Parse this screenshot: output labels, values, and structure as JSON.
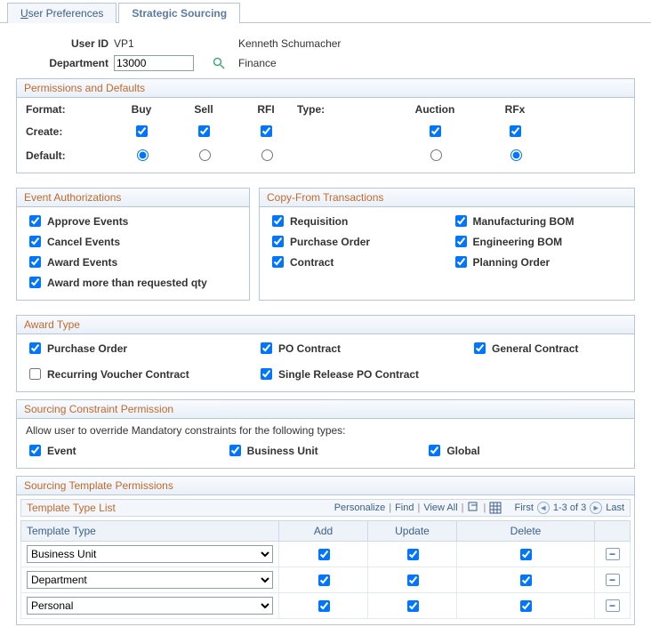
{
  "tabs": {
    "user_preferences": "User Preferences",
    "up_u": "U",
    "up_rest": "ser Preferences",
    "strategic_sourcing": "Strategic Sourcing"
  },
  "header": {
    "userid_label": "User ID",
    "userid": "VP1",
    "username": "Kenneth Schumacher",
    "dept_label": "Department",
    "dept_value": "13000",
    "dept_name": "Finance"
  },
  "perm": {
    "title": "Permissions and Defaults",
    "format": "Format:",
    "buy": "Buy",
    "sell": "Sell",
    "rfi": "RFI",
    "type": "Type:",
    "auction": "Auction",
    "rfx": "RFx",
    "create": "Create:",
    "default": "Default:"
  },
  "eventauth": {
    "title": "Event Authorizations",
    "approve": "Approve Events",
    "cancel": "Cancel Events",
    "award": "Award Events",
    "award_more": "Award more than requested qty"
  },
  "copyfrom": {
    "title": "Copy-From Transactions",
    "requisition": "Requisition",
    "po": "Purchase Order",
    "contract": "Contract",
    "mfg_bom": "Manufacturing BOM",
    "eng_bom": "Engineering BOM",
    "plan_order": "Planning Order"
  },
  "awardtype": {
    "title": "Award Type",
    "po": "Purchase Order",
    "po_contract": "PO Contract",
    "general": "General Contract",
    "recurring": "Recurring Voucher Contract",
    "single": "Single Release PO Contract"
  },
  "constraint": {
    "title": "Sourcing Constraint Permission",
    "help": "Allow user to override Mandatory constraints for the following types:",
    "event": "Event",
    "bu": "Business Unit",
    "global": "Global"
  },
  "tmpl": {
    "title": "Sourcing Template Permissions",
    "list_title": "Template Type List",
    "personalize": "Personalize",
    "find": "Find",
    "view_all": "View All",
    "first": "First",
    "range": "1-3 of 3",
    "last": "Last",
    "col_type": "Template Type",
    "col_add": "Add",
    "col_update": "Update",
    "col_delete": "Delete",
    "rows": [
      {
        "type": "Business Unit"
      },
      {
        "type": "Department"
      },
      {
        "type": "Personal"
      }
    ]
  }
}
